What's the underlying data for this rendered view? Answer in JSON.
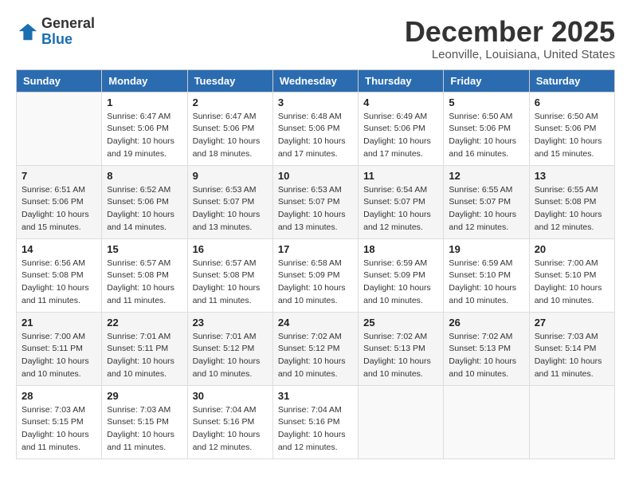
{
  "app": {
    "name_general": "General",
    "name_blue": "Blue"
  },
  "header": {
    "month": "December 2025",
    "location": "Leonville, Louisiana, United States"
  },
  "calendar": {
    "days_of_week": [
      "Sunday",
      "Monday",
      "Tuesday",
      "Wednesday",
      "Thursday",
      "Friday",
      "Saturday"
    ],
    "weeks": [
      [
        {
          "day": "",
          "empty": true
        },
        {
          "day": "1",
          "sunrise": "6:47 AM",
          "sunset": "5:06 PM",
          "daylight": "10 hours and 19 minutes."
        },
        {
          "day": "2",
          "sunrise": "6:47 AM",
          "sunset": "5:06 PM",
          "daylight": "10 hours and 18 minutes."
        },
        {
          "day": "3",
          "sunrise": "6:48 AM",
          "sunset": "5:06 PM",
          "daylight": "10 hours and 17 minutes."
        },
        {
          "day": "4",
          "sunrise": "6:49 AM",
          "sunset": "5:06 PM",
          "daylight": "10 hours and 17 minutes."
        },
        {
          "day": "5",
          "sunrise": "6:50 AM",
          "sunset": "5:06 PM",
          "daylight": "10 hours and 16 minutes."
        },
        {
          "day": "6",
          "sunrise": "6:50 AM",
          "sunset": "5:06 PM",
          "daylight": "10 hours and 15 minutes."
        }
      ],
      [
        {
          "day": "7",
          "sunrise": "6:51 AM",
          "sunset": "5:06 PM",
          "daylight": "10 hours and 15 minutes."
        },
        {
          "day": "8",
          "sunrise": "6:52 AM",
          "sunset": "5:06 PM",
          "daylight": "10 hours and 14 minutes."
        },
        {
          "day": "9",
          "sunrise": "6:53 AM",
          "sunset": "5:07 PM",
          "daylight": "10 hours and 13 minutes."
        },
        {
          "day": "10",
          "sunrise": "6:53 AM",
          "sunset": "5:07 PM",
          "daylight": "10 hours and 13 minutes."
        },
        {
          "day": "11",
          "sunrise": "6:54 AM",
          "sunset": "5:07 PM",
          "daylight": "10 hours and 12 minutes."
        },
        {
          "day": "12",
          "sunrise": "6:55 AM",
          "sunset": "5:07 PM",
          "daylight": "10 hours and 12 minutes."
        },
        {
          "day": "13",
          "sunrise": "6:55 AM",
          "sunset": "5:08 PM",
          "daylight": "10 hours and 12 minutes."
        }
      ],
      [
        {
          "day": "14",
          "sunrise": "6:56 AM",
          "sunset": "5:08 PM",
          "daylight": "10 hours and 11 minutes."
        },
        {
          "day": "15",
          "sunrise": "6:57 AM",
          "sunset": "5:08 PM",
          "daylight": "10 hours and 11 minutes."
        },
        {
          "day": "16",
          "sunrise": "6:57 AM",
          "sunset": "5:08 PM",
          "daylight": "10 hours and 11 minutes."
        },
        {
          "day": "17",
          "sunrise": "6:58 AM",
          "sunset": "5:09 PM",
          "daylight": "10 hours and 10 minutes."
        },
        {
          "day": "18",
          "sunrise": "6:59 AM",
          "sunset": "5:09 PM",
          "daylight": "10 hours and 10 minutes."
        },
        {
          "day": "19",
          "sunrise": "6:59 AM",
          "sunset": "5:10 PM",
          "daylight": "10 hours and 10 minutes."
        },
        {
          "day": "20",
          "sunrise": "7:00 AM",
          "sunset": "5:10 PM",
          "daylight": "10 hours and 10 minutes."
        }
      ],
      [
        {
          "day": "21",
          "sunrise": "7:00 AM",
          "sunset": "5:11 PM",
          "daylight": "10 hours and 10 minutes."
        },
        {
          "day": "22",
          "sunrise": "7:01 AM",
          "sunset": "5:11 PM",
          "daylight": "10 hours and 10 minutes."
        },
        {
          "day": "23",
          "sunrise": "7:01 AM",
          "sunset": "5:12 PM",
          "daylight": "10 hours and 10 minutes."
        },
        {
          "day": "24",
          "sunrise": "7:02 AM",
          "sunset": "5:12 PM",
          "daylight": "10 hours and 10 minutes."
        },
        {
          "day": "25",
          "sunrise": "7:02 AM",
          "sunset": "5:13 PM",
          "daylight": "10 hours and 10 minutes."
        },
        {
          "day": "26",
          "sunrise": "7:02 AM",
          "sunset": "5:13 PM",
          "daylight": "10 hours and 10 minutes."
        },
        {
          "day": "27",
          "sunrise": "7:03 AM",
          "sunset": "5:14 PM",
          "daylight": "10 hours and 11 minutes."
        }
      ],
      [
        {
          "day": "28",
          "sunrise": "7:03 AM",
          "sunset": "5:15 PM",
          "daylight": "10 hours and 11 minutes."
        },
        {
          "day": "29",
          "sunrise": "7:03 AM",
          "sunset": "5:15 PM",
          "daylight": "10 hours and 11 minutes."
        },
        {
          "day": "30",
          "sunrise": "7:04 AM",
          "sunset": "5:16 PM",
          "daylight": "10 hours and 12 minutes."
        },
        {
          "day": "31",
          "sunrise": "7:04 AM",
          "sunset": "5:16 PM",
          "daylight": "10 hours and 12 minutes."
        },
        {
          "day": "",
          "empty": true
        },
        {
          "day": "",
          "empty": true
        },
        {
          "day": "",
          "empty": true
        }
      ]
    ]
  }
}
